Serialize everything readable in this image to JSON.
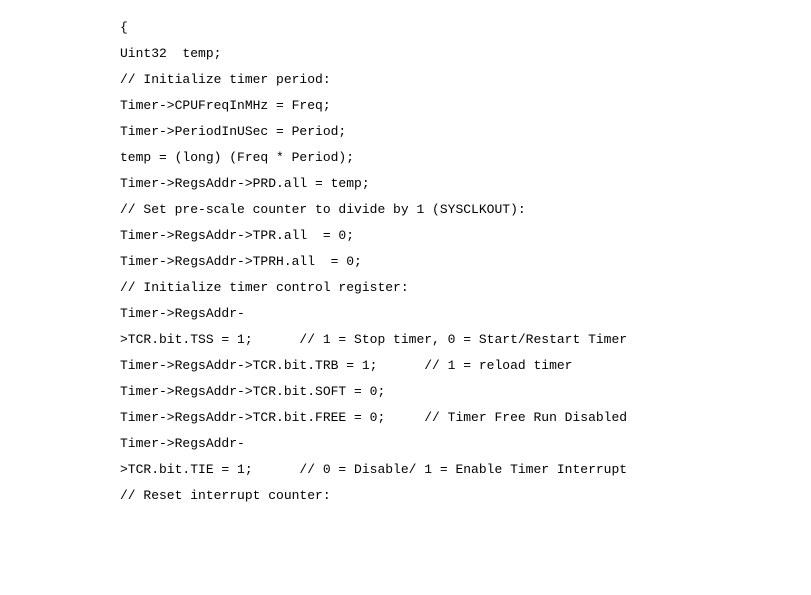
{
  "lines": [
    "{",
    "Uint32  temp;",
    "",
    "// Initialize timer period:",
    "Timer->CPUFreqInMHz = Freq;",
    "Timer->PeriodInUSec = Period;",
    "temp = (long) (Freq * Period);",
    "Timer->RegsAddr->PRD.all = temp;",
    "",
    "// Set pre-scale counter to divide by 1 (SYSCLKOUT):",
    "Timer->RegsAddr->TPR.all  = 0;",
    "Timer->RegsAddr->TPRH.all  = 0;",
    "",
    "// Initialize timer control register:",
    "Timer->RegsAddr-",
    ">TCR.bit.TSS = 1;      // 1 = Stop timer, 0 = Start/Restart Timer",
    "Timer->RegsAddr->TCR.bit.TRB = 1;      // 1 = reload timer",
    "Timer->RegsAddr->TCR.bit.SOFT = 0;",
    "Timer->RegsAddr->TCR.bit.FREE = 0;     // Timer Free Run Disabled",
    "Timer->RegsAddr-",
    ">TCR.bit.TIE = 1;      // 0 = Disable/ 1 = Enable Timer Interrupt",
    "",
    "// Reset interrupt counter:"
  ]
}
